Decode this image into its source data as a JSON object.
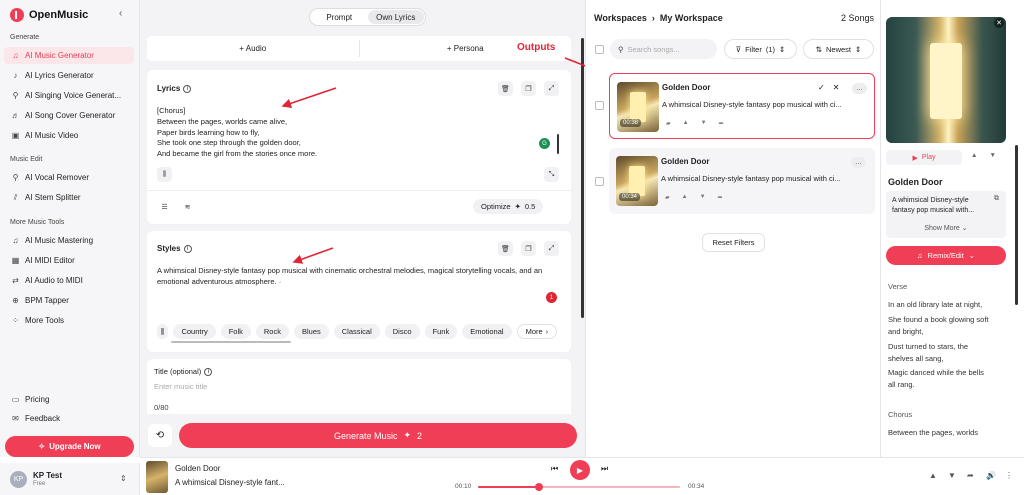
{
  "brand": {
    "name": "OpenMusic",
    "accent": "#ef3e55"
  },
  "sidebar": {
    "sections": [
      "Generate",
      "Music Edit",
      "More Music Tools"
    ],
    "generate": [
      {
        "label": "AI Music Generator",
        "active": true,
        "icon": "music-note-icon"
      },
      {
        "label": "AI Lyrics Generator",
        "icon": "lyrics-icon"
      },
      {
        "label": "AI Singing Voice Generat...",
        "icon": "mic-icon"
      },
      {
        "label": "AI Song Cover Generator",
        "icon": "cover-icon"
      },
      {
        "label": "AI Music Video",
        "icon": "video-icon"
      }
    ],
    "edit": [
      {
        "label": "AI Vocal Remover",
        "icon": "vocal-icon"
      },
      {
        "label": "AI Stem Splitter",
        "icon": "split-icon"
      }
    ],
    "tools": [
      {
        "label": "AI Music Mastering",
        "icon": "mastering-icon"
      },
      {
        "label": "AI MIDI Editor",
        "icon": "midi-icon"
      },
      {
        "label": "AI Audio to MIDI",
        "icon": "audio-midi-icon"
      },
      {
        "label": "BPM Tapper",
        "icon": "tap-icon"
      },
      {
        "label": "More Tools",
        "icon": "grid-icon"
      }
    ],
    "footer": [
      {
        "label": "Pricing"
      },
      {
        "label": "Feedback"
      }
    ],
    "upgrade": "Upgrade Now",
    "user": {
      "initials": "KP",
      "name": "KP Test",
      "plan": "Free"
    }
  },
  "composer": {
    "tabs": [
      "Prompt",
      "Own Lyrics"
    ],
    "add": [
      "+ Audio",
      "+ Persona"
    ],
    "lyrics_title": "Lyrics",
    "lyrics": [
      "[Chorus]",
      "Between the pages, worlds came alive,",
      "Paper birds learning how to fly,",
      "She took one step through the golden door,",
      "And became the girl from the stories once more."
    ],
    "optimize": "Optimize",
    "optimize_cost": "0.5",
    "styles_title": "Styles",
    "styles_text": "A whimsical Disney-style fantasy pop musical with cinematic orchestral melodies, magical storytelling vocals, and an emotional adventurous atmosphere. ·",
    "styles_badge": "1",
    "genres": [
      "Country",
      "Folk",
      "Rock",
      "Blues",
      "Classical",
      "Disco",
      "Funk",
      "Emotional"
    ],
    "more": "More",
    "title_label": "Title (optional)",
    "title_placeholder": "Enter music title",
    "title_count": "0/80",
    "generate": "Generate Music",
    "generate_cost": "2"
  },
  "annotation": "Outputs",
  "workspace": {
    "crumb": "Workspaces",
    "name": "My Workspace",
    "count": "2 Songs",
    "search_placeholder": "Search songs...",
    "filter": "Filter",
    "filter_count": "(1)",
    "sort": "Newest",
    "songs": [
      {
        "title": "Golden Door",
        "desc": "A whimsical Disney-style fantasy pop musical with ci...",
        "dur": "00:38"
      },
      {
        "title": "Golden Door",
        "desc": "A whimsical Disney-style fantasy pop musical with ci...",
        "dur": "00:34"
      }
    ],
    "reset": "Reset Filters"
  },
  "detail": {
    "play": "Play",
    "title": "Golden Door",
    "desc": "A whimsical Disney-style fantasy pop musical with...",
    "show_more": "Show More",
    "remix": "Remix/Edit",
    "verse_label": "Verse",
    "verse": [
      "In an old library late at night,",
      "She found a book glowing soft",
      "and bright,",
      "Dust turned to stars, the",
      "shelves all sang,",
      "Magic danced while the bells",
      "all rang."
    ],
    "chorus_label": "Chorus",
    "chorus": [
      "Between the pages, worlds"
    ]
  },
  "player": {
    "title": "Golden Door",
    "desc": "A whimsical Disney-style fant...",
    "elapsed": "00:10",
    "total": "00:34",
    "progress": 0.3
  }
}
